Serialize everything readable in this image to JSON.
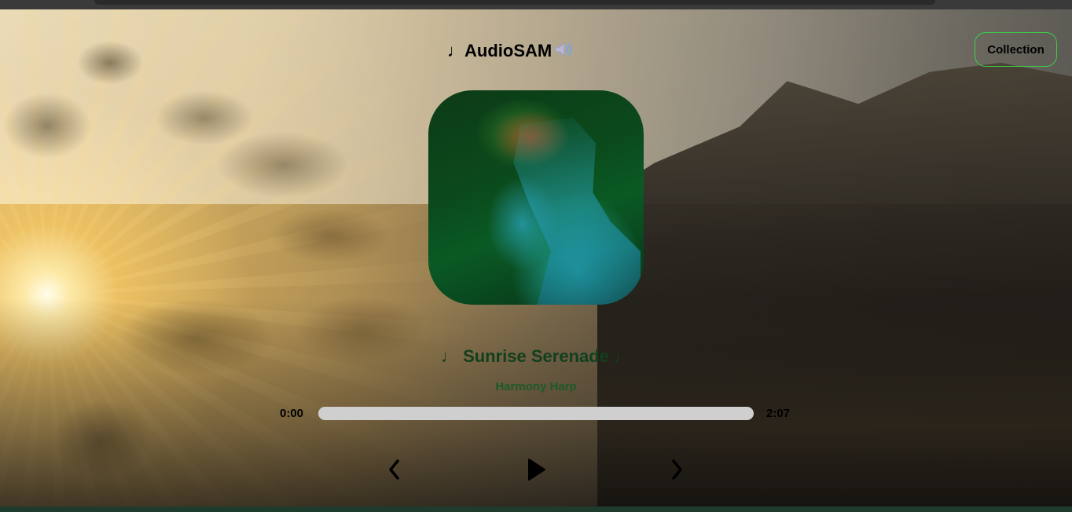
{
  "header": {
    "app_title": "♩AudioSAM",
    "speaker_icon": "speaker-icon",
    "collection_label": "Collection"
  },
  "track": {
    "title": "♩ Sunrise Serenade ♩",
    "artist": "Harmony Harp",
    "cover_icon": "album-cover"
  },
  "player": {
    "current_time": "0:00",
    "total_time": "2:07",
    "progress": 0,
    "prev_icon": "chevron-left-icon",
    "play_icon": "play-icon",
    "next_icon": "chevron-right-icon"
  },
  "colors": {
    "accent_border": "#3bd14a",
    "song_title": "#123f1d",
    "artist": "#1c5a2a",
    "progress_track": "#cfcfcf"
  }
}
